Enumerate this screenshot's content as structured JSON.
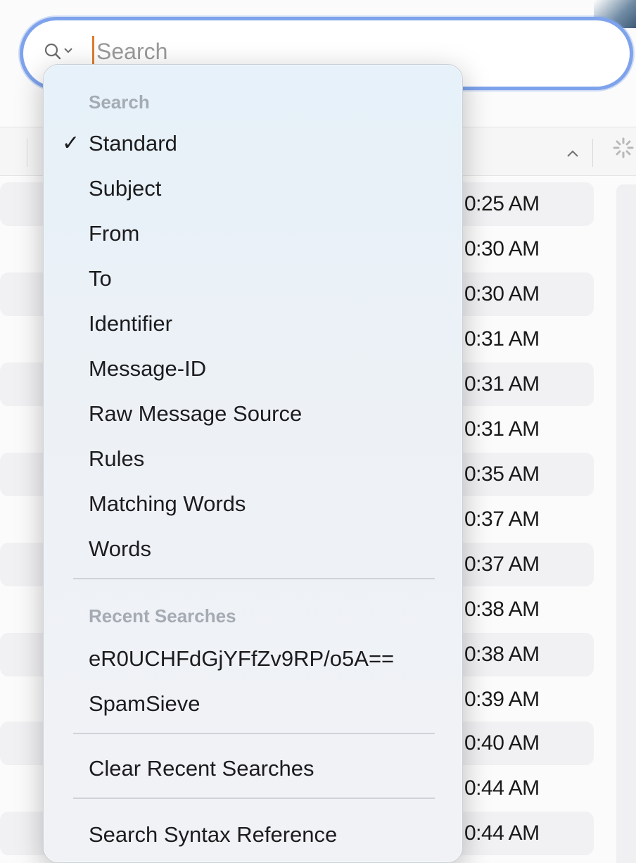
{
  "search": {
    "placeholder": "Search"
  },
  "message_list": {
    "times": [
      "0:25 AM",
      "0:30 AM",
      "0:30 AM",
      "0:31 AM",
      "0:31 AM",
      "0:31 AM",
      "0:35 AM",
      "0:37 AM",
      "0:37 AM",
      "0:38 AM",
      "0:38 AM",
      "0:39 AM",
      "0:40 AM",
      "0:44 AM",
      "0:44 AM"
    ]
  },
  "menu": {
    "search_section": "Search",
    "search_items": [
      {
        "label": "Standard",
        "checked": true
      },
      {
        "label": "Subject",
        "checked": false
      },
      {
        "label": "From",
        "checked": false
      },
      {
        "label": "To",
        "checked": false
      },
      {
        "label": "Identifier",
        "checked": false
      },
      {
        "label": "Message-ID",
        "checked": false
      },
      {
        "label": "Raw Message Source",
        "checked": false
      },
      {
        "label": "Rules",
        "checked": false
      },
      {
        "label": "Matching Words",
        "checked": false
      },
      {
        "label": "Words",
        "checked": false
      }
    ],
    "check_mark": "✓",
    "recent_section": "Recent Searches",
    "recent_items": [
      "eR0UCHFdGjYFfZv9RP/o5A==",
      "SpamSieve"
    ],
    "clear_label": "Clear Recent Searches",
    "syntax_label": "Search Syntax Reference"
  },
  "colors": {
    "focus_ring": "#7ea3ec",
    "caret": "#e07a2c"
  },
  "icons": {
    "search_field": "magnifying-glass-icon",
    "search_menu": "chevron-down-icon",
    "sort": "chevron-up-icon",
    "activity": "spinner-icon"
  }
}
